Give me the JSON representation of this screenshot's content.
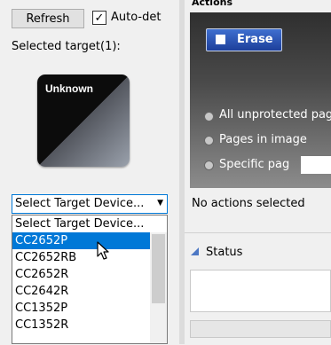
{
  "left_panel": {
    "refresh_label": "Refresh",
    "auto_detect_label": "Auto-det",
    "auto_detect_checked": "✓",
    "selected_target_label": "Selected target(1):",
    "device_tile_name": "Unknown",
    "target_select_value": "Select Target Device...",
    "dropdown_items": [
      "Select Target Device...",
      "CC2652P",
      "CC2652RB",
      "CC2652R",
      "CC2642R",
      "CC1352P",
      "CC1352R"
    ],
    "dropdown_highlighted": "CC2652P"
  },
  "right_panel": {
    "actions_header": "Actions",
    "erase_tab_label": "Erase",
    "radio_options": [
      "All unprotected pag",
      "Pages in image",
      "Specific pag"
    ],
    "no_actions_text": "No actions selected",
    "status_label": "Status"
  },
  "colors": {
    "accent": "#0078d7",
    "erase_tab": "#2a52b5",
    "status_arrow": "#4d78c4"
  }
}
